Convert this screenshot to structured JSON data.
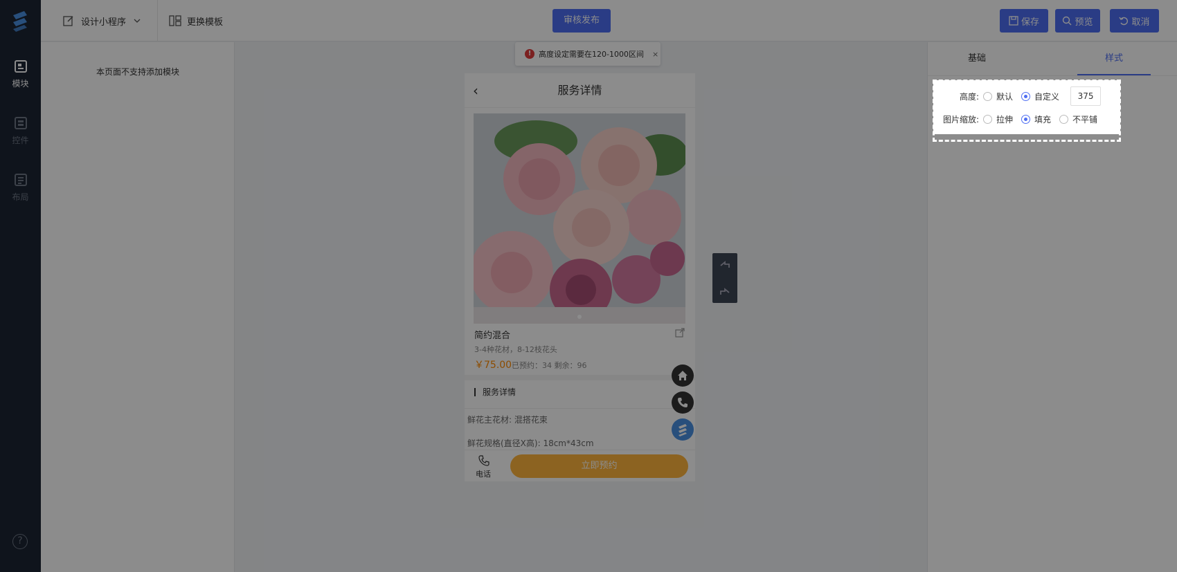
{
  "topbar": {
    "design_label": "设计小程序",
    "switch_template": "更换模板",
    "review_publish": "审核发布",
    "save": "保存",
    "preview": "预览",
    "cancel": "取消"
  },
  "sidebar": {
    "items": [
      {
        "label": "模块",
        "icon": "module-icon",
        "active": true
      },
      {
        "label": "控件",
        "icon": "widget-icon",
        "active": false
      },
      {
        "label": "布局",
        "icon": "layout-icon",
        "active": false
      }
    ]
  },
  "module_panel": {
    "message": "本页面不支持添加模块"
  },
  "toast": {
    "text": "高度设定需要在120-1000区间",
    "close": "×"
  },
  "phone": {
    "header_title": "服务详情",
    "back": "‹",
    "product_name": "简约混合",
    "product_desc": "3-4种花材，8-12枝花头",
    "price": "￥75.00",
    "stats": "已预约：34  剩余：96",
    "section_title": "服务详情",
    "detail_1": "鲜花主花材: 混搭花束",
    "detail_2": "鲜花规格(直径X高): 18cm*43cm",
    "footer_phone_label": "电话",
    "book_button": "立即预约"
  },
  "right_panel": {
    "tabs": [
      {
        "label": "基础",
        "active": false
      },
      {
        "label": "样式",
        "active": true
      }
    ],
    "height_label": "高度:",
    "height_options": [
      {
        "label": "默认",
        "selected": false
      },
      {
        "label": "自定义",
        "selected": true
      }
    ],
    "height_value": "375",
    "scale_label": "图片缩放:",
    "scale_options": [
      {
        "label": "拉伸",
        "selected": false
      },
      {
        "label": "填充",
        "selected": true
      },
      {
        "label": "不平铺",
        "selected": false
      }
    ]
  },
  "colors": {
    "accent": "#4e6ef2",
    "nav_bg": "#1d2634",
    "book_button": "#ffb53d",
    "price": "#ff8a00",
    "error": "#e03b3b"
  }
}
